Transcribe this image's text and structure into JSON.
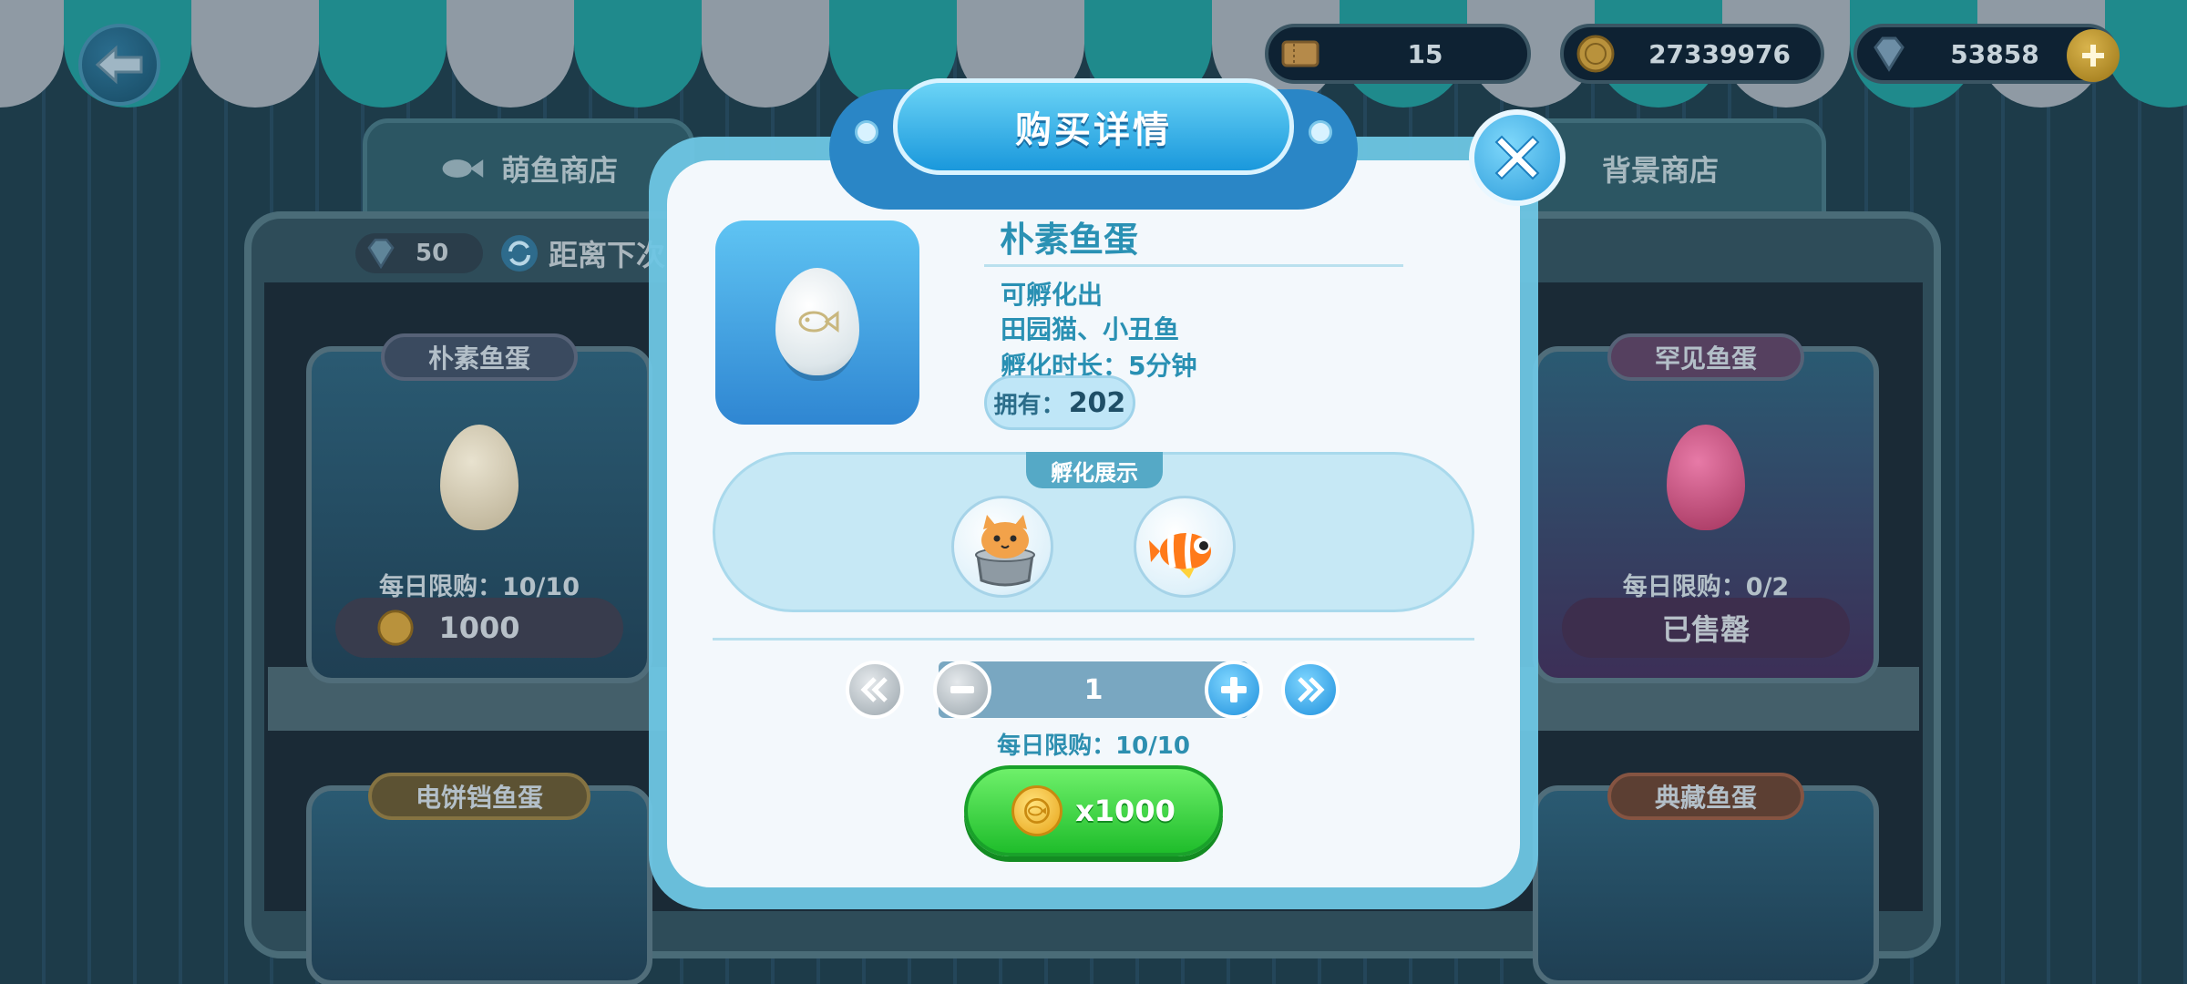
{
  "hud": {
    "tickets": "15",
    "coins": "27339976",
    "gems": "53858"
  },
  "shop_tabs": {
    "cute_fish_shop": "萌鱼商店",
    "background_shop": "背景商店"
  },
  "shop_bar": {
    "gem_count": "50",
    "next_refresh_label": "距离下次"
  },
  "cards": [
    {
      "title": "朴素鱼蛋",
      "limit": "每日限购：10/10",
      "price": "1000"
    },
    {
      "title": "罕见鱼蛋",
      "limit": "每日限购：0/2",
      "price": "已售罄"
    },
    {
      "title": "电饼铛鱼蛋"
    },
    {
      "title": "典藏鱼蛋"
    }
  ],
  "modal": {
    "title": "购买详情",
    "item_name": "朴素鱼蛋",
    "info": [
      "可孵化出",
      "田园猫、小丑鱼",
      "孵化时长：5分钟"
    ],
    "owned_label": "拥有：",
    "owned_value": "202",
    "hatch_label": "孵化展示",
    "pets": [
      "cat-in-pot",
      "clownfish"
    ],
    "quantity": "1",
    "daily_limit": "每日限购：10/10",
    "buy_label": "x1000"
  },
  "colors": {
    "modal_text": "#2a91b4",
    "buy_green": "#1fbd2b",
    "accent_blue": "#1e8fdc"
  }
}
